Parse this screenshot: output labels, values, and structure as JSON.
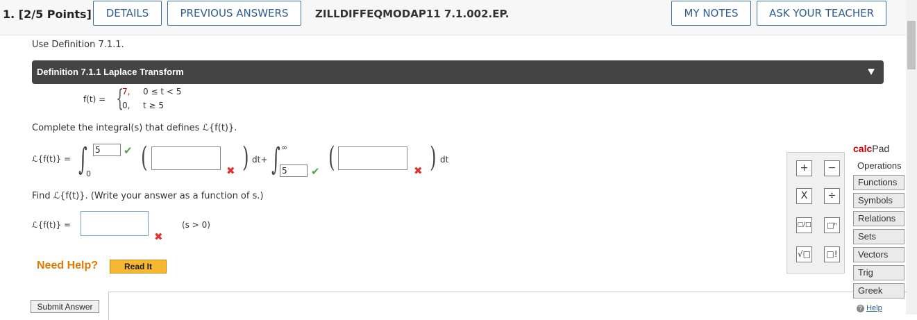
{
  "header": {
    "question_label": "1.  [2/5 Points]",
    "details_label": "DETAILS",
    "previous_answers_label": "PREVIOUS ANSWERS",
    "question_id": "ZILLDIFFEQMODAP11 7.1.002.EP.",
    "my_notes_label": "MY NOTES",
    "ask_teacher_label": "ASK YOUR TEACHER"
  },
  "body": {
    "instruction": "Use Definition 7.1.1.",
    "definition_title": "Definition 7.1.1 Laplace Transform",
    "piecewise": {
      "lhs": "f(t) = ",
      "case1_value": "7,",
      "case1_cond": "0 ≤ t < 5",
      "case2_value": "0,",
      "case2_cond": "t ≥ 5"
    },
    "complete_prompt": "Complete the integral(s) that defines ℒ{f(t)}.",
    "lhs_transform": "ℒ{f(t)} =",
    "integral1_lower": "0",
    "integral1_upper_value": "5",
    "integrand1_value": "",
    "dt_plus": "dt+",
    "integral2_upper": "∞",
    "integral2_lower_value": "5",
    "integrand2_value": "",
    "dt": "dt",
    "find_prompt": "Find ℒ{f(t)}. (Write your answer as a function of s.)",
    "answer_lhs": "ℒ{f(t)} =",
    "answer_value": "",
    "condition": "(s > 0)",
    "need_help": "Need Help?",
    "read_it": "Read It",
    "submit": "Submit Answer"
  },
  "calcpad": {
    "title_bold": "calc",
    "title_rest": "Pad",
    "buttons": [
      "+",
      "−",
      "X",
      "÷",
      "□/□",
      "□ⁿ",
      "√□",
      "□!"
    ],
    "tabs": [
      "Operations",
      "Functions",
      "Symbols",
      "Relations",
      "Sets",
      "Vectors",
      "Trig",
      "Greek"
    ],
    "help": "Help"
  },
  "colors": {
    "accent_blue": "#2b5d92",
    "definition_bar": "#444444",
    "need_help_orange": "#e07b00",
    "error_red": "#e03030",
    "correct_green": "#4fa34f"
  }
}
